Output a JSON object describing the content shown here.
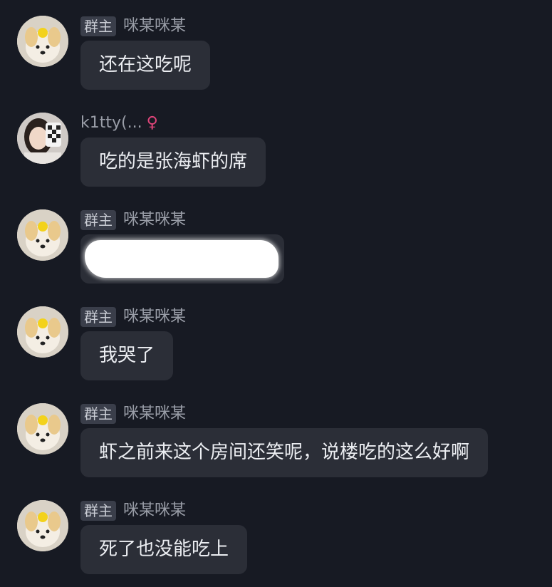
{
  "messages": [
    {
      "role": "群主",
      "sender": "咪某咪某",
      "text": "还在这吃呢",
      "avatar": "puppy-avatar"
    },
    {
      "role": "",
      "sender": "k1tty(...",
      "text": "吃的是张海虾的席",
      "avatar": "girl-avatar",
      "gender_icon": "♀"
    },
    {
      "role": "群主",
      "sender": "咪某咪某",
      "text": "",
      "avatar": "puppy-avatar",
      "redacted": true
    },
    {
      "role": "群主",
      "sender": "咪某咪某",
      "text": "我哭了",
      "avatar": "puppy-avatar"
    },
    {
      "role": "群主",
      "sender": "咪某咪某",
      "text": "虾之前来这个房间还笑呢，说楼吃的这么好啊",
      "avatar": "puppy-avatar"
    },
    {
      "role": "群主",
      "sender": "咪某咪某",
      "text": "死了也没能吃上",
      "avatar": "puppy-avatar"
    }
  ],
  "colors": {
    "background": "#171a23",
    "bubble": "#2b2e37",
    "badge": "#3a3e4a",
    "female_icon": "#e0457a"
  }
}
